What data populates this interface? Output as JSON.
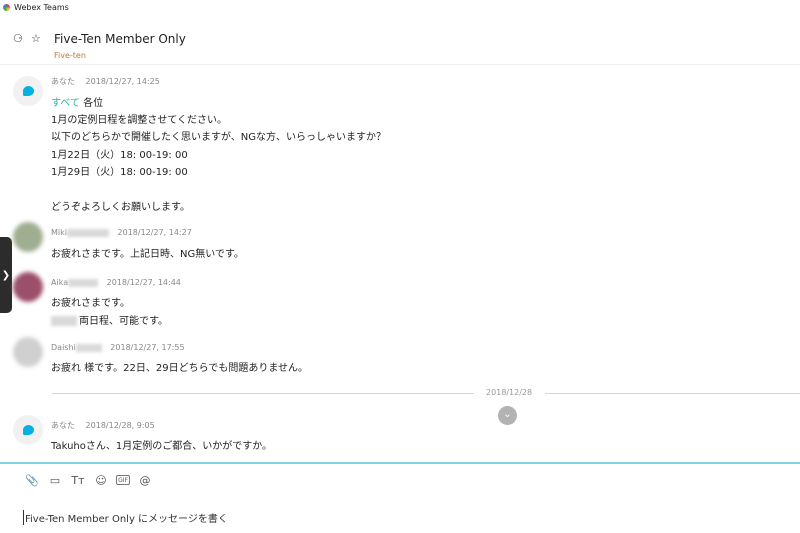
{
  "app": {
    "title": "Webex Teams"
  },
  "header": {
    "space_title": "Five-Ten Member Only",
    "space_subtitle": "Five-ten"
  },
  "messages": [
    {
      "author": "あなた",
      "time": "2018/12/27, 14:25",
      "mention": "すべて",
      "after_mention": " 各位",
      "lines": [
        "1月の定例日程を調整させてください。",
        "以下のどちらかで開催したく思いますが、NGな方、いらっしゃいますか？",
        "1月22日（火）18: 00-19: 00",
        "1月29日（火）18: 00-19: 00",
        "どうぞよろしくお願いします。"
      ]
    },
    {
      "author": "Miki",
      "time": "2018/12/27, 14:27",
      "lines": [
        "お疲れさまです。上記日時、NG無いです。"
      ]
    },
    {
      "author": "Aika",
      "time": "2018/12/27, 14:44",
      "lines": [
        "お疲れさまです。",
        "両日程、可能です。"
      ]
    },
    {
      "author": "Daishi",
      "time": "2018/12/27, 17:55",
      "lines": [
        "お疲れ 様です。22日、29日どちらでも問題ありません。"
      ]
    },
    {
      "author": "あなた",
      "time": "2018/12/28, 9:05",
      "lines": [
        "Takuhoさん、1月定例のご都合、いかがですか。"
      ]
    }
  ],
  "divider": {
    "date": "2018/12/28"
  },
  "composer": {
    "placeholder": "Five-Ten Member Only にメッセージを書く",
    "gif_label": "GIF"
  },
  "colors": {
    "accent": "#05b1e0",
    "mention": "#2bb3a0",
    "subtitle": "#c0793b"
  }
}
